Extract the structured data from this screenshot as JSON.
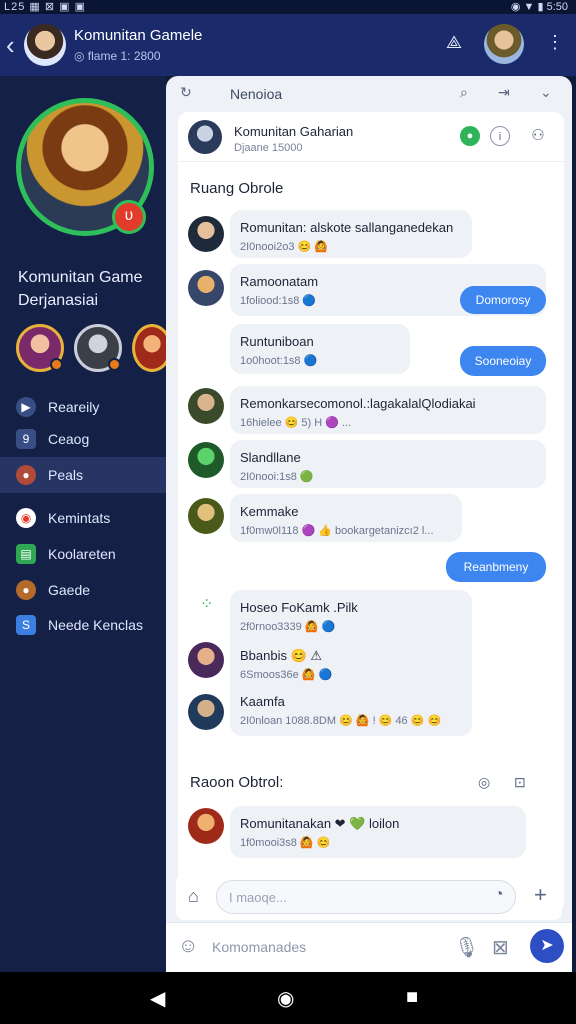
{
  "status": {
    "left": "L25 ▦ ⊠ ▣ ▣",
    "right": "◉ ▼ ▮ 5:50"
  },
  "appbar": {
    "title": "Komunitan Gamele",
    "subtitle": "◎ flame 1: 2800",
    "back_icon": "chevron-left-icon"
  },
  "sidebar": {
    "group_name_line1": "Komunitan Game",
    "group_name_line2": "Derjanasiai",
    "menu": [
      {
        "label": "Reareily",
        "icon": "▶",
        "color": "#3a4e86"
      },
      {
        "label": "Ceaog",
        "icon": "9",
        "color": "#3a4e86"
      },
      {
        "label": "Peals",
        "icon": "●",
        "color": "#b04b3a"
      },
      {
        "label": "Kemintats",
        "icon": "◉",
        "color": "#e23b2b"
      },
      {
        "label": "Koolareten",
        "icon": "▤",
        "color": "#2fa856"
      },
      {
        "label": "Gaede",
        "icon": "●",
        "color": "#b36a2a"
      },
      {
        "label": "Neede Kenclas",
        "icon": "S",
        "color": "#3d7fe0"
      }
    ]
  },
  "panel": {
    "title": "Nenoioa"
  },
  "channel": {
    "name": "Komunitan Gaharian",
    "meta": "Djaane 15000"
  },
  "section1": "Ruang Obrolе",
  "messages": [
    {
      "text": "Romunitan: alskote sallanganedekan",
      "meta": "2I0nooi2o3 😊 🙆"
    },
    {
      "text": "Ramoonatam",
      "meta": "1foliood:1s8 🔵",
      "reply": "Domorosy"
    },
    {
      "text": "Runtuniboan",
      "meta": "1o0hoot:1s8 🔵",
      "reply": "Sooneoiay"
    },
    {
      "text": "Remonkarsecomonol.:lagakalalQlodiakai",
      "meta": "16hielee 😊 5) H 🟣 ...",
      "reply": ""
    },
    {
      "text": "Slandllane",
      "meta": "2I0nooi:1s8 🟢"
    },
    {
      "text": "Kemmake",
      "meta": "1f0mw0l118 🟣 👍 bookargetanizcı2 l...",
      "reply2": "Reanbmeny"
    },
    {
      "text": "Hoseo FoKamk .Pilk",
      "meta": "2f0rnoo3339 🙆 🔵"
    },
    {
      "text": "Bbanbis 😊 ⚠",
      "meta": "6Smoos36e 🙆 🔵"
    },
    {
      "text": "Kaamfa",
      "meta": "2I0nloan 1088.8DM 😊 🙆 ! 😊 46 😊 😊"
    }
  ],
  "section2": "Raoon Obtrol:",
  "last_message": {
    "text": "Romunitanakan ❤ 💚 loilon",
    "meta": "1f0mooi3s8 🙆 😊"
  },
  "composer": {
    "placeholder": "I maoqe..."
  },
  "bottom_input": {
    "placeholder": "Komomanades"
  }
}
